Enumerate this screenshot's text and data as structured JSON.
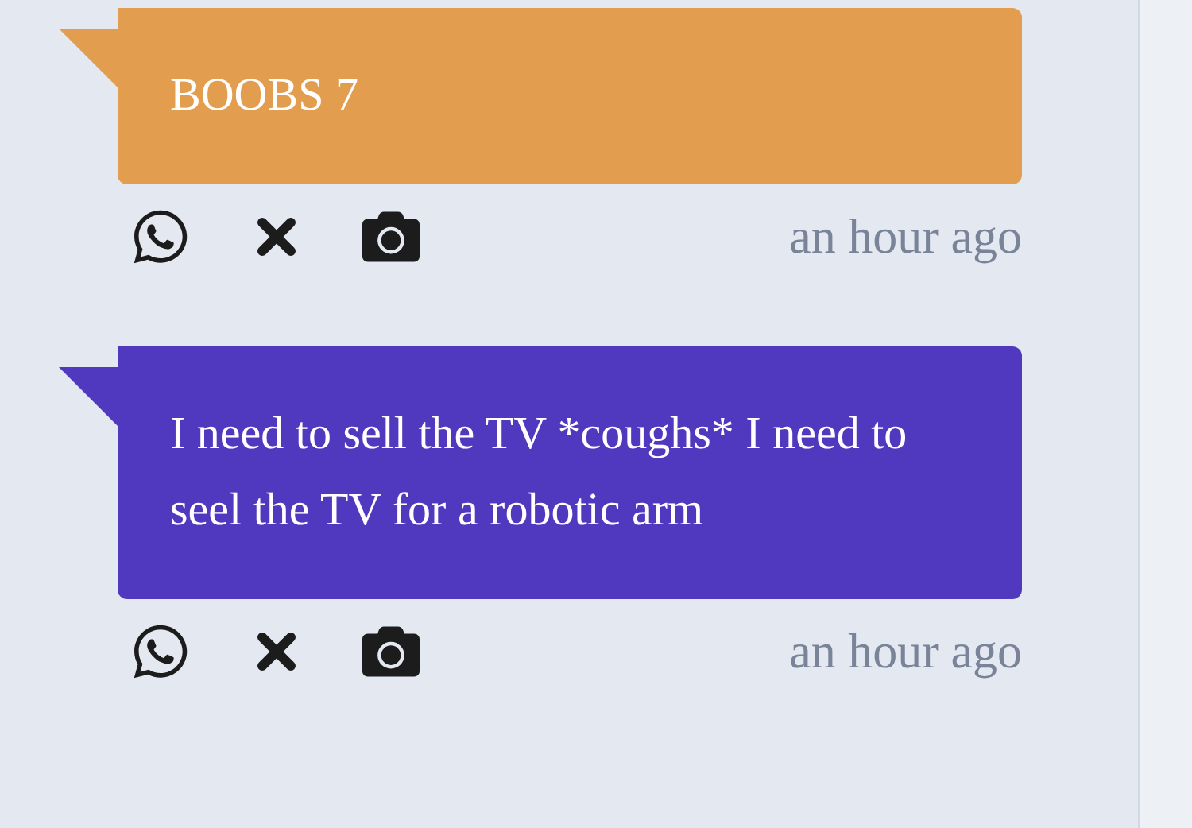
{
  "messages": [
    {
      "text": "BOOBS 7",
      "color": "#e29e4e",
      "time": "an hour ago"
    },
    {
      "text": "I need to sell the TV *coughs* I need to seel the TV for a robotic arm",
      "color": "#5038bf",
      "time": "an hour ago"
    }
  ]
}
